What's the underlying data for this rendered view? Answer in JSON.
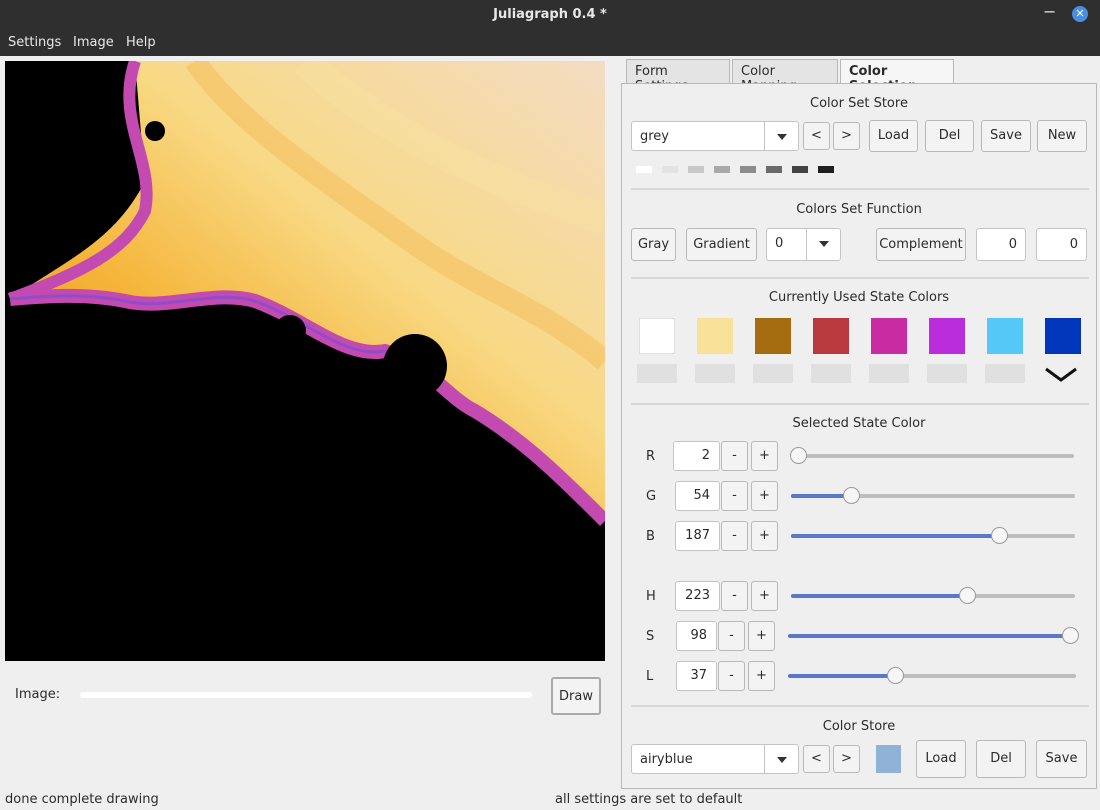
{
  "window": {
    "title": "Juliagraph 0.4 *",
    "minimize": "−",
    "close": "✕"
  },
  "menu": {
    "settings": "Settings",
    "image": "Image",
    "help": "Help"
  },
  "tabs": {
    "form": "Form Settings",
    "mapping": "Color Mapping",
    "selection": "Color Selection"
  },
  "color_set_store": {
    "heading": "Color Set Store",
    "selected": "grey",
    "prev": "<",
    "next": ">",
    "load": "Load",
    "del": "Del",
    "save": "Save",
    "new": "New",
    "chips": [
      "#ffffff",
      "#e3e3e3",
      "#c8c8c8",
      "#a9a9a9",
      "#8c8c8c",
      "#6a6a6a",
      "#434343",
      "#1f1f1f"
    ]
  },
  "colors_set_function": {
    "heading": "Colors Set Function",
    "gray": "Gray",
    "gradient": "Gradient",
    "gradient_value": "0",
    "complement": "Complement",
    "value1": "0",
    "value2": "0"
  },
  "state_colors": {
    "heading": "Currently Used State Colors",
    "colors": [
      "#ffffff",
      "#f8e29a",
      "#a46c0e",
      "#b93a3e",
      "#c92ba3",
      "#bb2cdb",
      "#55c8f8",
      "#0236bb"
    ],
    "selected_marker": "selected-chevron-icon"
  },
  "selected_state_color": {
    "heading": "Selected State Color",
    "R": {
      "label": "R",
      "value": "2",
      "fraction": 0.008
    },
    "G": {
      "label": "G",
      "value": "54",
      "fraction": 0.212
    },
    "B": {
      "label": "B",
      "value": "187",
      "fraction": 0.733
    },
    "H": {
      "label": "H",
      "value": "223",
      "fraction": 0.619
    },
    "S": {
      "label": "S",
      "value": "98",
      "fraction": 0.98
    },
    "L": {
      "label": "L",
      "value": "37",
      "fraction": 0.37
    },
    "minus": "-",
    "plus": "+"
  },
  "color_store": {
    "heading": "Color Store",
    "selected": "airyblue",
    "prev": "<",
    "next": ">",
    "swatch": "#8fb2d6",
    "load": "Load",
    "del": "Del",
    "save": "Save"
  },
  "image_row": {
    "label": "Image:",
    "progress": 0.0,
    "draw": "Draw"
  },
  "status": {
    "left": "done complete drawing",
    "right": "all settings are set to default"
  }
}
